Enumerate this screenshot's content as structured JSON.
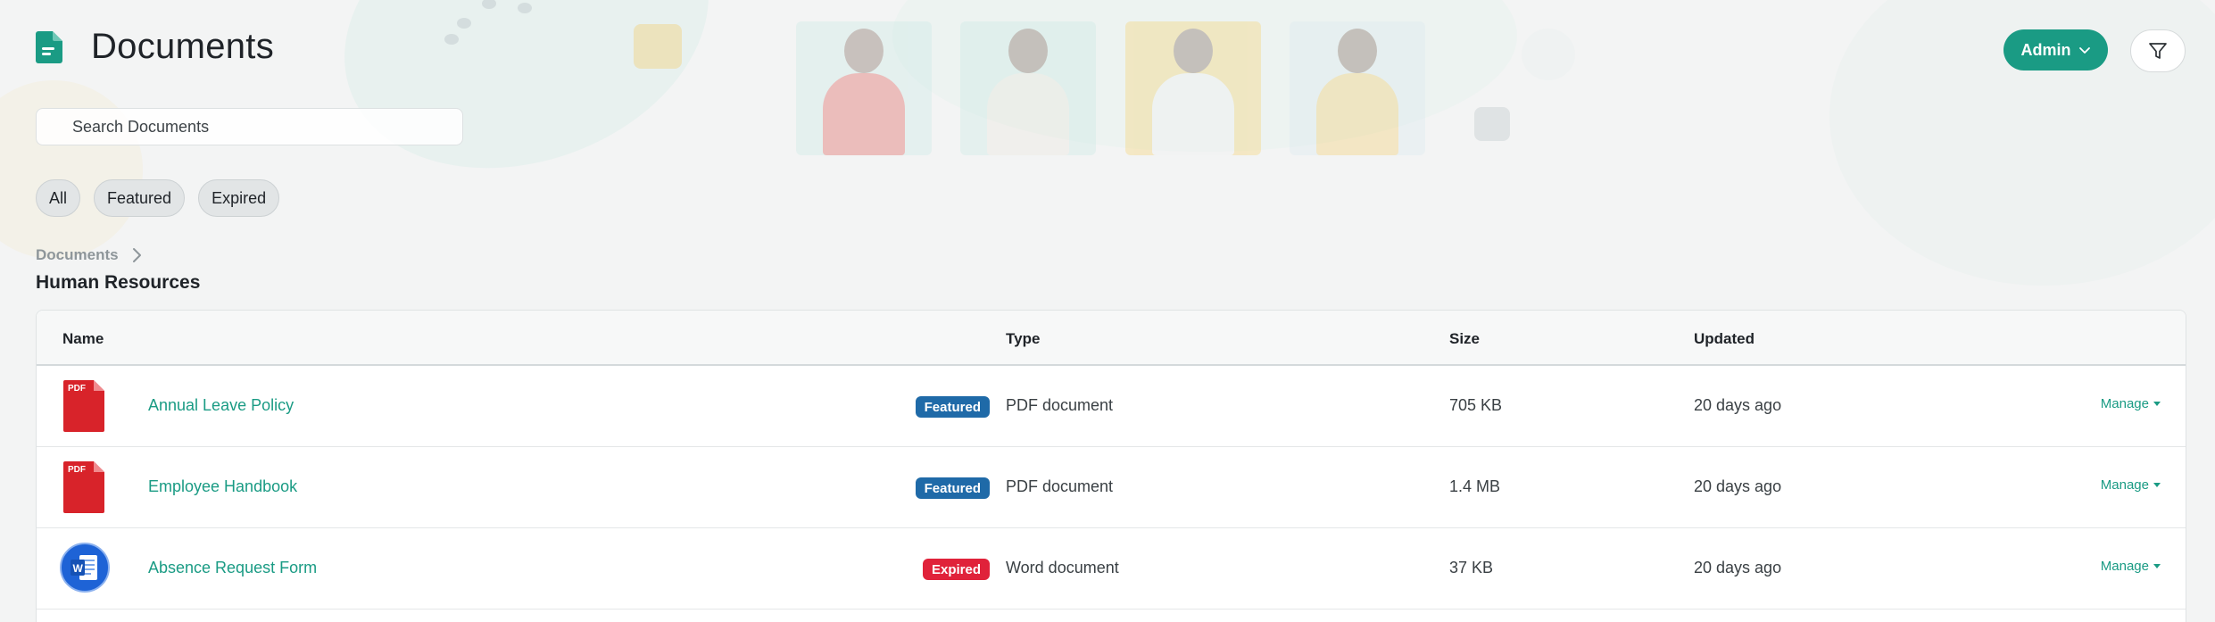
{
  "header": {
    "title": "Documents",
    "admin_label": "Admin",
    "icons": {
      "page": "document-icon",
      "filter": "filter-icon",
      "admin_chevron": "chevron-down-icon"
    }
  },
  "search": {
    "placeholder": "Search Documents",
    "value": ""
  },
  "filters": [
    {
      "label": "All"
    },
    {
      "label": "Featured"
    },
    {
      "label": "Expired"
    }
  ],
  "breadcrumb": {
    "root": "Documents",
    "separator_icon": "chevron-right-icon"
  },
  "section": {
    "title": "Human Resources"
  },
  "table": {
    "columns": {
      "name": "Name",
      "type": "Type",
      "size": "Size",
      "updated": "Updated"
    },
    "rows": [
      {
        "name": "Annual Leave Policy",
        "badge": "Featured",
        "badge_kind": "featured",
        "type": "PDF document",
        "size": "705 KB",
        "updated": "20 days ago",
        "action": "Manage",
        "icon": "pdf-file-icon",
        "icon_label": "PDF"
      },
      {
        "name": "Employee Handbook",
        "badge": "Featured",
        "badge_kind": "featured",
        "type": "PDF document",
        "size": "1.4 MB",
        "updated": "20 days ago",
        "action": "Manage",
        "icon": "pdf-file-icon",
        "icon_label": "PDF"
      },
      {
        "name": "Absence Request Form",
        "badge": "Expired",
        "badge_kind": "expired",
        "type": "Word document",
        "size": "37 KB",
        "updated": "20 days ago",
        "action": "Manage",
        "icon": "word-file-icon",
        "icon_label": "W"
      }
    ]
  },
  "colors": {
    "accent": "#1a9b84",
    "featured_badge": "#1f6aa8",
    "expired_badge": "#e0223a",
    "pdf_red": "#d8232a",
    "word_blue": "#1e63d6"
  }
}
